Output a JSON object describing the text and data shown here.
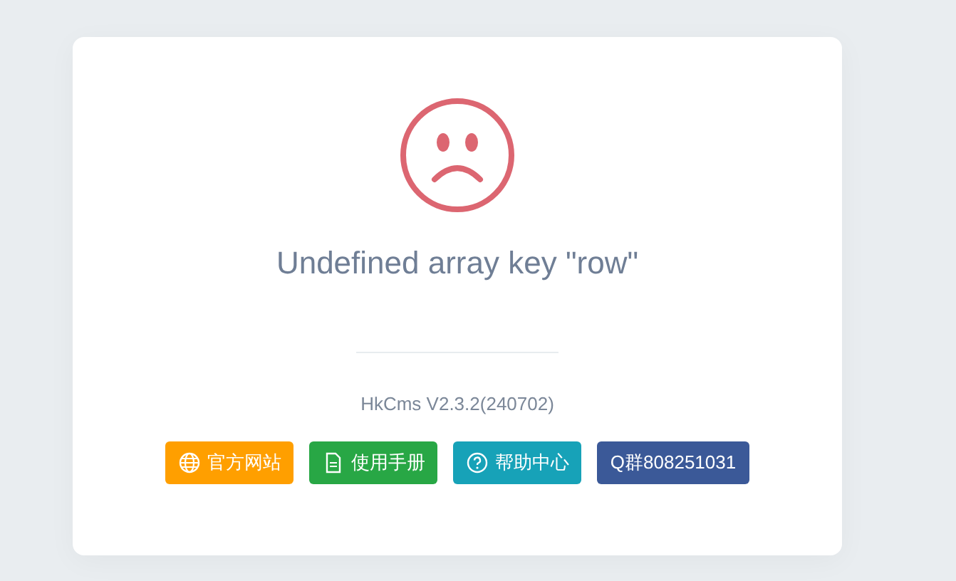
{
  "error": {
    "message": "Undefined array key \"row\"",
    "version": "HkCms V2.3.2(240702)"
  },
  "buttons": [
    {
      "label": "官方网站",
      "kind": "globe",
      "color": "#ff9f00"
    },
    {
      "label": "使用手册",
      "kind": "document",
      "color": "#28a745"
    },
    {
      "label": "帮助中心",
      "kind": "question",
      "color": "#17a2b8"
    },
    {
      "label": "Q群808251031",
      "kind": "plain",
      "color": "#3b5998"
    }
  ]
}
